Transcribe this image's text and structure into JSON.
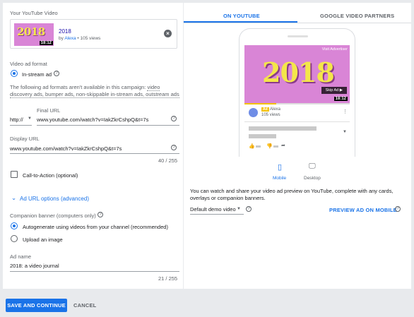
{
  "left": {
    "video_section_label": "Your YouTube Video",
    "video": {
      "thumb_text": "2018",
      "duration": "18:12",
      "title": "2018",
      "by": "by",
      "channel": "Alexa",
      "views": "• 105 views"
    },
    "ad_format_label": "Video ad format",
    "ad_format_option": "In-stream ad",
    "ad_format_note": "The following ad formats aren't available in this campaign:",
    "ad_format_links": "video discovery ads, bumper ads, non-skippable in-stream ads, outstream ads",
    "final_url": {
      "label": "Final URL",
      "prefix": "http://",
      "value": "www.youtube.com/watch?v=IakZkrCshpQ&t=7s"
    },
    "display_url": {
      "label": "Display URL",
      "value": "www.youtube.com/watch?v=IakZkrCshpQ&t=7s",
      "counter": "40 / 255"
    },
    "cta_label": "Call-to-Action (optional)",
    "ad_url_options": "Ad URL options (advanced)",
    "companion": {
      "label": "Companion banner (computers only)",
      "option_auto": "Autogenerate using videos from your channel (recommended)",
      "option_upload": "Upload an image"
    },
    "ad_name": {
      "label": "Ad name",
      "value": "2018: a video journal",
      "counter": "21 / 255"
    }
  },
  "right": {
    "tabs": [
      {
        "label": "ON YOUTUBE"
      },
      {
        "label": "GOOGLE VIDEO PARTNERS"
      }
    ],
    "preview": {
      "visit": "Visit Advertiser",
      "year": "2018",
      "skip": "Skip Ad ▶",
      "duration": "18:12",
      "ad_badge": "Ad",
      "channel": "Alexa",
      "views": "105 views"
    },
    "devices": [
      {
        "label": "Mobile",
        "icon": "phone-icon"
      },
      {
        "label": "Desktop",
        "icon": "monitor-icon"
      }
    ],
    "info": "You can watch and share your video ad preview on YouTube, complete with any cards, overlays or companion banners.",
    "demo_select": "Default demo video",
    "preview_link": "PREVIEW AD ON MOBILE"
  },
  "footer": {
    "save": "SAVE AND CONTINUE",
    "cancel": "CANCEL"
  },
  "colors": {
    "accent": "#1a73e8",
    "thumb_bg": "#d985d6",
    "year_yellow": "#f4e64a",
    "ad_yellow": "#f4c20d"
  },
  "progress_fraction": 0.3
}
